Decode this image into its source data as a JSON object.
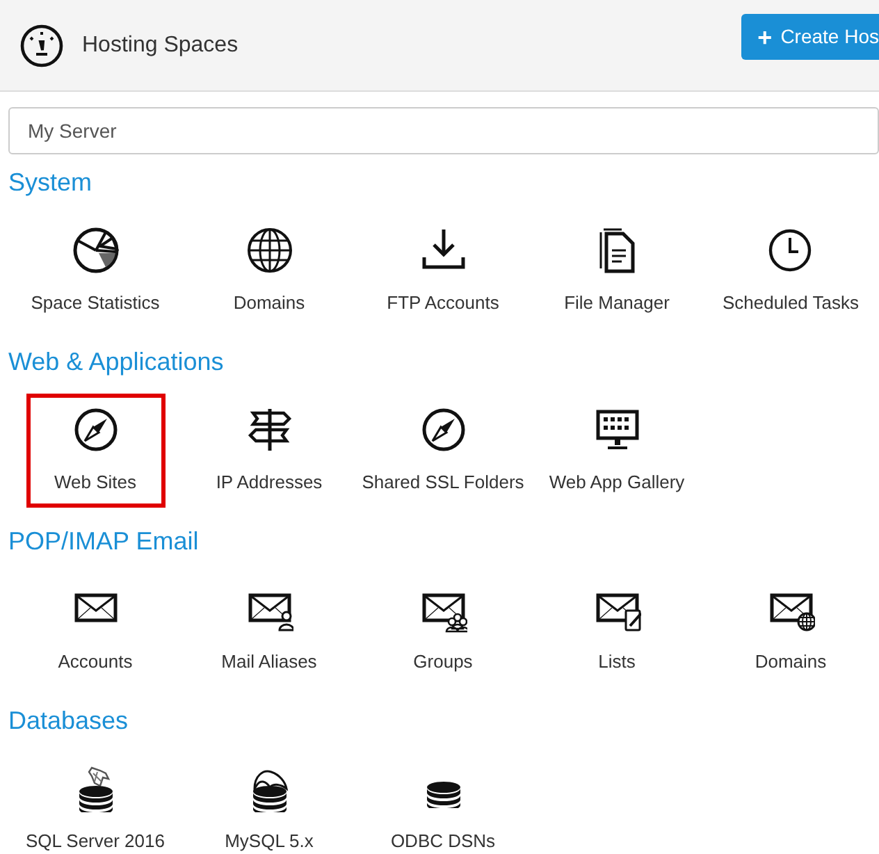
{
  "header": {
    "title": "Hosting Spaces",
    "button": {
      "icon": "+",
      "label": "Create Hos"
    }
  },
  "server_select": {
    "value": "My Server"
  },
  "sections": [
    {
      "title": "System",
      "items": [
        {
          "label": "Space Statistics",
          "kind": "pie",
          "highlighted": false
        },
        {
          "label": "Domains",
          "kind": "globe",
          "highlighted": false
        },
        {
          "label": "FTP Accounts",
          "kind": "download",
          "highlighted": false
        },
        {
          "label": "File Manager",
          "kind": "file",
          "highlighted": false
        },
        {
          "label": "Scheduled Tasks",
          "kind": "clock",
          "highlighted": false
        }
      ]
    },
    {
      "title": "Web & Applications",
      "items": [
        {
          "label": "Web Sites",
          "kind": "compass",
          "highlighted": true
        },
        {
          "label": "IP Addresses",
          "kind": "signpost",
          "highlighted": false
        },
        {
          "label": "Shared SSL Folders",
          "kind": "compass",
          "highlighted": false
        },
        {
          "label": "Web App Gallery",
          "kind": "monitor",
          "highlighted": false
        }
      ]
    },
    {
      "title": "POP/IMAP Email",
      "items": [
        {
          "label": "Accounts",
          "kind": "mail",
          "highlighted": false
        },
        {
          "label": "Mail Aliases",
          "kind": "mail-user",
          "highlighted": false
        },
        {
          "label": "Groups",
          "kind": "mail-group",
          "highlighted": false
        },
        {
          "label": "Lists",
          "kind": "mail-edit",
          "highlighted": false
        },
        {
          "label": "Domains",
          "kind": "mail-globe",
          "highlighted": false
        }
      ]
    },
    {
      "title": "Databases",
      "items": [
        {
          "label": "SQL Server 2016",
          "kind": "db-figure",
          "highlighted": false
        },
        {
          "label": "MySQL 5.x",
          "kind": "db-dolphin",
          "highlighted": false
        },
        {
          "label": "ODBC DSNs",
          "kind": "db",
          "highlighted": false
        }
      ]
    }
  ]
}
